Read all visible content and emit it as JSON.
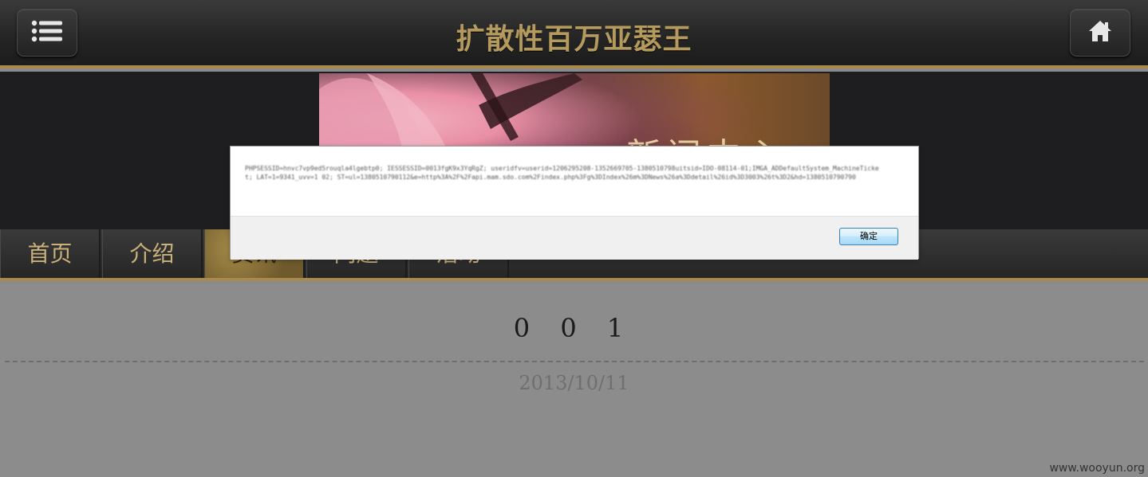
{
  "header": {
    "title": "扩散性百万亚瑟王",
    "menu_icon": "list-icon",
    "home_icon": "home-icon"
  },
  "banner": {
    "text": "新闻中心"
  },
  "nav": {
    "tabs": [
      {
        "label": "首页"
      },
      {
        "label": "介绍"
      },
      {
        "label": "资讯"
      },
      {
        "label": "问题"
      },
      {
        "label": "活动"
      }
    ],
    "active_index": 2
  },
  "post": {
    "title": "0 0 1",
    "date": "2013/10/11"
  },
  "dialog": {
    "message": "PHPSESSID=hnvc7vp9ed5rouqla4lgebtp0; IESSESSID=0013fgK9x3YqRgZ; useridfv=userid=1206295208-1352669705-1380510798uitsid=IDO-08114-01;IMGA_ADDefaultSystem_MachineTicket; LAT=1=9341_uvv=1 02; ST=ul=1380510790112&e=http%3A%2F%2Fapi.mam.sdo.com%2Findex.php%3Fg%3DIndex%26m%3DNews%26a%3Ddetail%26id%3D3003%26t%3D2&hd=1380510790790",
    "ok_label": "确定"
  },
  "watermark": "www.wooyun.org"
}
